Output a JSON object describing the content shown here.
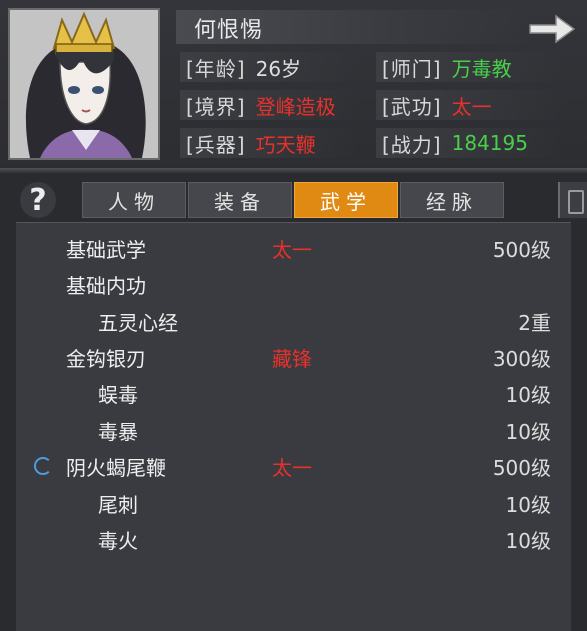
{
  "character": {
    "name": "何恨惕",
    "next_icon": "arrow-right-icon",
    "portrait": "female-character-portrait"
  },
  "info": {
    "age_label": "[年龄]",
    "age_value": "26岁",
    "school_label": "[师门]",
    "school_value": "万毒教",
    "realm_label": "[境界]",
    "realm_value": "登峰造极",
    "martial_label": "[武功]",
    "martial_value": "太一",
    "weapon_label": "[兵器]",
    "weapon_value": "巧天鞭",
    "power_label": "[战力]",
    "power_value": "184195"
  },
  "help_label": "?",
  "tabs": [
    {
      "label": "人物"
    },
    {
      "label": "装备"
    },
    {
      "label": "武学"
    },
    {
      "label": "经脉"
    }
  ],
  "active_tab": "武学",
  "skills": [
    {
      "name": "基础武学",
      "tier": "太一",
      "level": "500级"
    },
    {
      "name": "基础内功",
      "tier": "",
      "level": ""
    },
    {
      "name": "五灵心经",
      "tier": "",
      "level": "2重"
    },
    {
      "name": "金钩银刃",
      "tier": "藏锋",
      "level": "300级"
    },
    {
      "name": "蜈毒",
      "tier": "",
      "level": "10级"
    },
    {
      "name": "毒暴",
      "tier": "",
      "level": "10级"
    },
    {
      "name": "阴火蝎尾鞭",
      "tier": "太一",
      "level": "500级"
    },
    {
      "name": "尾刺",
      "tier": "",
      "level": "10级"
    },
    {
      "name": "毒火",
      "tier": "",
      "level": "10级"
    }
  ],
  "colors": {
    "accent_tab": "#e08a14",
    "red": "#e8312a",
    "green": "#48d04c"
  }
}
